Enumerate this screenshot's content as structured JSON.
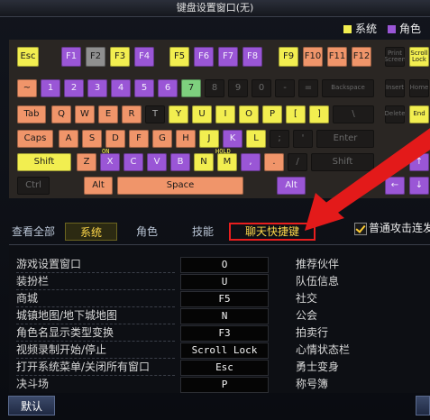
{
  "window": {
    "title": "键盘设置窗口(无)"
  },
  "legend": [
    {
      "label": "系统",
      "color": "#f2ee50"
    },
    {
      "label": "角色",
      "color": "#9a56d6"
    }
  ],
  "keyboard": {
    "row0": [
      "Esc",
      "F1",
      "F2",
      "F3",
      "F4",
      "F5",
      "F6",
      "F7",
      "F8",
      "F9",
      "F10",
      "F11",
      "F12",
      "Print Screen",
      "Scroll Lock"
    ],
    "row1": [
      "~",
      "1",
      "2",
      "3",
      "4",
      "5",
      "6",
      "7",
      "8",
      "9",
      "0",
      "-",
      "=",
      "Backspace",
      "Insert",
      "Home"
    ],
    "row2": [
      "Tab",
      "Q",
      "W",
      "E",
      "R",
      "T",
      "Y",
      "U",
      "I",
      "O",
      "P",
      "[",
      "]",
      "\\",
      "Delete",
      "End"
    ],
    "row3": [
      "Caps",
      "A",
      "S",
      "D",
      "F",
      "G",
      "H",
      "J",
      "K",
      "L",
      ";",
      "'",
      "Enter"
    ],
    "row4": [
      "Shift",
      "Z",
      "X",
      "C",
      "V",
      "B",
      "N",
      "M",
      ",",
      ".",
      "/",
      "Shift",
      "↑"
    ],
    "row5": [
      "Ctrl",
      "Alt",
      "Space",
      "Alt",
      "←",
      "↓"
    ],
    "tags": {
      "x": "ON",
      "m": "HOLD"
    }
  },
  "tabs": [
    {
      "label": "查看全部"
    },
    {
      "label": "系统"
    },
    {
      "label": "角色"
    },
    {
      "label": "技能"
    },
    {
      "label": "聊天快捷键"
    }
  ],
  "checkbox": {
    "label": "普通攻击连发"
  },
  "bindings": [
    {
      "label": "游戏设置窗口",
      "key": "O",
      "right": "推荐伙伴"
    },
    {
      "label": "装扮栏",
      "key": "U",
      "right": "队伍信息"
    },
    {
      "label": "商城",
      "key": "F5",
      "right": "社交"
    },
    {
      "label": "城镇地图/地下城地图",
      "key": "N",
      "right": "公会"
    },
    {
      "label": "角色名显示类型变换",
      "key": "F3",
      "right": "拍卖行"
    },
    {
      "label": "视频录制开始/停止",
      "key": "Scroll Lock",
      "right": "心情状态栏"
    },
    {
      "label": "打开系统菜单/关闭所有窗口",
      "key": "Esc",
      "right": "勇士变身"
    },
    {
      "label": "决斗场",
      "key": "P",
      "right": "称号簿"
    }
  ],
  "buttons": {
    "default_label": "默认"
  }
}
